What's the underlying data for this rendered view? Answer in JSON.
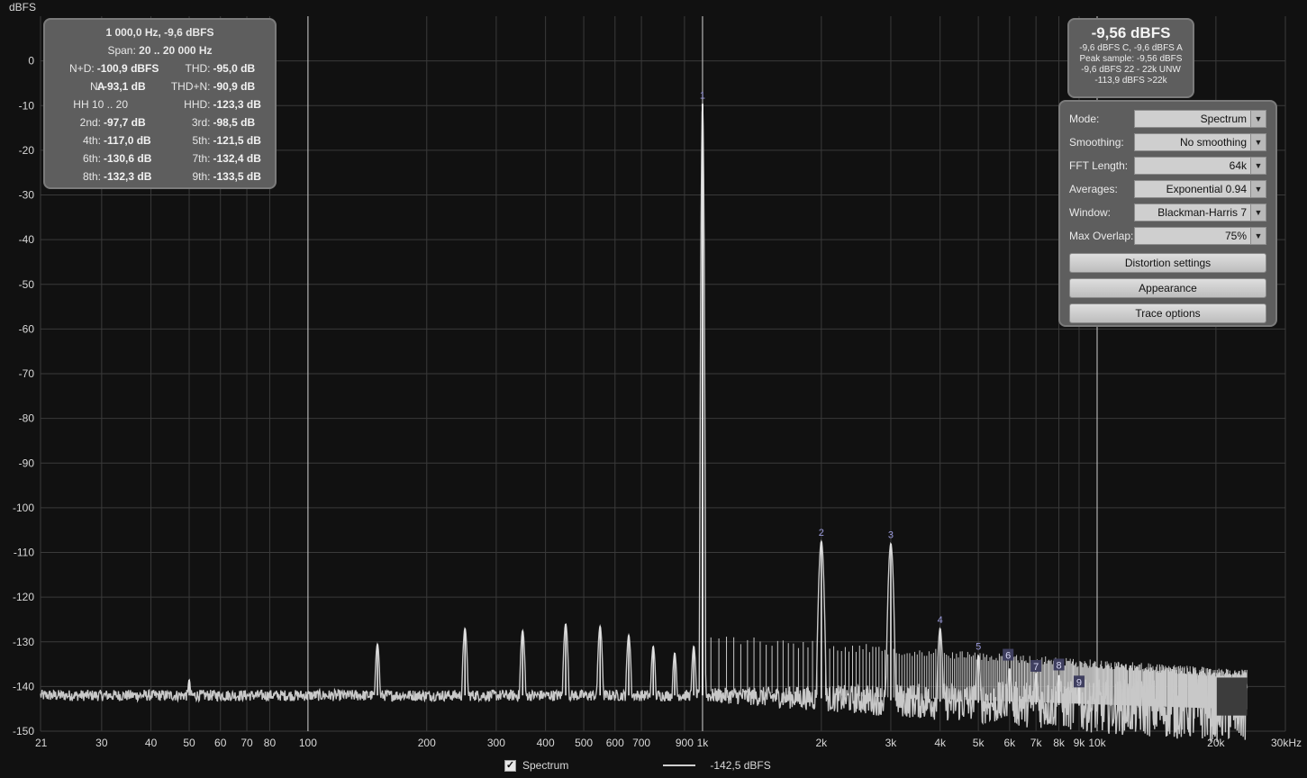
{
  "chart_data": {
    "type": "line",
    "ylabel": "dBFS",
    "xlabel": "",
    "x_scale": "log",
    "xlim": [
      21,
      30000
    ],
    "ylim": [
      -150,
      10
    ],
    "y_ticks": [
      0,
      -10,
      -20,
      -30,
      -40,
      -50,
      -60,
      -70,
      -80,
      -90,
      -100,
      -110,
      -120,
      -130,
      -140,
      -150
    ],
    "x_ticks": [
      {
        "v": 21,
        "label": "21"
      },
      {
        "v": 30,
        "label": "30"
      },
      {
        "v": 40,
        "label": "40"
      },
      {
        "v": 50,
        "label": "50"
      },
      {
        "v": 60,
        "label": "60"
      },
      {
        "v": 70,
        "label": "70"
      },
      {
        "v": 80,
        "label": "80"
      },
      {
        "v": 100,
        "label": "100"
      },
      {
        "v": 200,
        "label": "200"
      },
      {
        "v": 300,
        "label": "300"
      },
      {
        "v": 400,
        "label": "400"
      },
      {
        "v": 500,
        "label": "500"
      },
      {
        "v": 600,
        "label": "600"
      },
      {
        "v": 700,
        "label": "700"
      },
      {
        "v": 900,
        "label": "900"
      },
      {
        "v": 1000,
        "label": "1k"
      },
      {
        "v": 2000,
        "label": "2k"
      },
      {
        "v": 3000,
        "label": "3k"
      },
      {
        "v": 4000,
        "label": "4k"
      },
      {
        "v": 5000,
        "label": "5k"
      },
      {
        "v": 6000,
        "label": "6k"
      },
      {
        "v": 7000,
        "label": "7k"
      },
      {
        "v": 8000,
        "label": "8k"
      },
      {
        "v": 9000,
        "label": "9k"
      },
      {
        "v": 10000,
        "label": "10k"
      },
      {
        "v": 20000,
        "label": "20k"
      },
      {
        "v": 30000,
        "label": "30kHz"
      }
    ],
    "series": [
      {
        "name": "Spectrum",
        "noise_floor": -142,
        "peaks": [
          {
            "f": 50,
            "db": -138.5
          },
          {
            "f": 150,
            "db": -130.5
          },
          {
            "f": 250,
            "db": -127
          },
          {
            "f": 350,
            "db": -127.5
          },
          {
            "f": 450,
            "db": -126
          },
          {
            "f": 550,
            "db": -126.5
          },
          {
            "f": 650,
            "db": -128.5
          },
          {
            "f": 750,
            "db": -131
          },
          {
            "f": 850,
            "db": -132.5
          },
          {
            "f": 950,
            "db": -131
          },
          {
            "f": 1000,
            "db": -9.6
          },
          {
            "f": 2000,
            "db": -107.5
          },
          {
            "f": 3000,
            "db": -108
          },
          {
            "f": 4000,
            "db": -127
          },
          {
            "f": 5000,
            "db": -133
          },
          {
            "f": 6000,
            "db": -136
          },
          {
            "f": 7000,
            "db": -137
          },
          {
            "f": 8000,
            "db": -137.5
          },
          {
            "f": 9000,
            "db": -139
          }
        ]
      }
    ],
    "harmonic_markers": [
      {
        "label": "1",
        "f": 1000,
        "db": -9.6,
        "boxed": false
      },
      {
        "label": "2",
        "f": 2000,
        "db": -107.5,
        "boxed": false
      },
      {
        "label": "3",
        "f": 3000,
        "db": -108,
        "boxed": false
      },
      {
        "label": "4",
        "f": 4000,
        "db": -127,
        "boxed": false
      },
      {
        "label": "5",
        "f": 5000,
        "db": -133,
        "boxed": false
      },
      {
        "label": "6",
        "f": 5950,
        "db": -135,
        "boxed": true
      },
      {
        "label": "7",
        "f": 7000,
        "db": -137.5,
        "boxed": true
      },
      {
        "label": "8",
        "f": 8000,
        "db": -137.2,
        "boxed": true
      },
      {
        "label": "9",
        "f": 9000,
        "db": -141,
        "boxed": true
      }
    ],
    "cursor_lines_hz": [
      100,
      1000,
      10000
    ],
    "colors": {
      "background": "#111111",
      "grid": "#3a3a3a",
      "trace": "#c8c8c8",
      "marker_text": "#9b9bdc",
      "marker_box": "#3f3f5f"
    }
  },
  "stats": {
    "title": "1 000,0 Hz, -9,6 dBFS",
    "span_label": "Span:",
    "span_value": "20 .. 20 000 Hz",
    "rows": [
      [
        {
          "label": "N+D:",
          "value": "-100,9 dBFS A"
        },
        {
          "label": "THD:",
          "value": "-95,0 dB"
        }
      ],
      [
        {
          "label": "N:",
          "value": "-93,1 dB"
        },
        {
          "label": "THD+N:",
          "value": "-90,9 dB"
        }
      ],
      [
        {
          "label": "HH 10 .. 20",
          "value": ""
        },
        {
          "label": "HHD:",
          "value": "-123,3 dB"
        }
      ],
      [
        {
          "label": "2nd:",
          "value": "-97,7 dB"
        },
        {
          "label": "3rd:",
          "value": "-98,5 dB"
        }
      ],
      [
        {
          "label": "4th:",
          "value": "-117,0 dB"
        },
        {
          "label": "5th:",
          "value": "-121,5 dB"
        }
      ],
      [
        {
          "label": "6th:",
          "value": "-130,6 dB"
        },
        {
          "label": "7th:",
          "value": "-132,4 dB"
        }
      ],
      [
        {
          "label": "8th:",
          "value": "-132,3 dB"
        },
        {
          "label": "9th:",
          "value": "-133,5 dB"
        }
      ]
    ]
  },
  "level": {
    "main": "-9,56 dBFS",
    "line1": "-9,6 dBFS C, -9,6 dBFS A",
    "line2": "Peak sample: -9,56 dBFS",
    "line3": "-9,6 dBFS 22 - 22k UNW",
    "line4": "-113,9 dBFS >22k"
  },
  "controls": {
    "mode": {
      "label": "Mode:",
      "value": "Spectrum"
    },
    "smoothing": {
      "label": "Smoothing:",
      "value": "No  smoothing"
    },
    "fft": {
      "label": "FFT Length:",
      "value": "64k"
    },
    "averages": {
      "label": "Averages:",
      "value": "Exponential 0.94"
    },
    "window": {
      "label": "Window:",
      "value": "Blackman-Harris 7"
    },
    "overlap": {
      "label": "Max Overlap:",
      "value": "75%"
    },
    "distortion_button": "Distortion settings",
    "appearance_button": "Appearance",
    "trace_button": "Trace options"
  },
  "legend": {
    "checked": true,
    "name": "Spectrum",
    "value": "-142,5 dBFS"
  }
}
